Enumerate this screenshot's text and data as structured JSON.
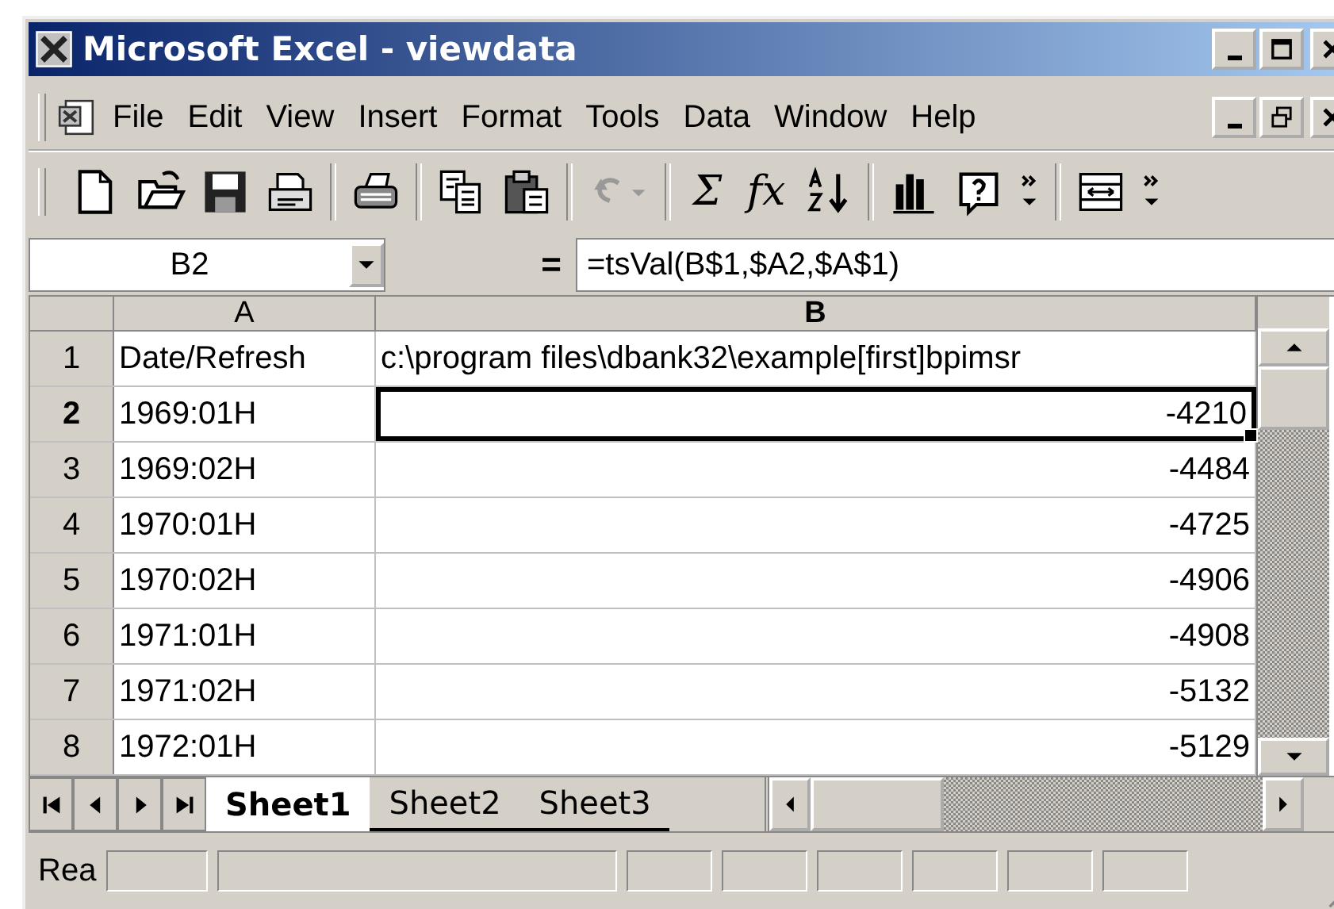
{
  "window": {
    "title": "Microsoft Excel - viewdata"
  },
  "menu": [
    {
      "label": "File"
    },
    {
      "label": "Edit"
    },
    {
      "label": "View"
    },
    {
      "label": "Insert"
    },
    {
      "label": "Format"
    },
    {
      "label": "Tools"
    },
    {
      "label": "Data"
    },
    {
      "label": "Window"
    },
    {
      "label": "Help"
    }
  ],
  "toolbar": [
    {
      "kind": "new"
    },
    {
      "kind": "open"
    },
    {
      "kind": "save"
    },
    {
      "kind": "mail"
    },
    {
      "kind": "sep"
    },
    {
      "kind": "print"
    },
    {
      "kind": "sep"
    },
    {
      "kind": "copy"
    },
    {
      "kind": "paste"
    },
    {
      "kind": "sep"
    },
    {
      "kind": "undo",
      "disabled": true
    },
    {
      "kind": "sep"
    },
    {
      "kind": "glyph",
      "text": "Σ"
    },
    {
      "kind": "glyph",
      "text": "fx"
    },
    {
      "kind": "sort"
    },
    {
      "kind": "sep"
    },
    {
      "kind": "chart"
    },
    {
      "kind": "help"
    },
    {
      "kind": "more"
    },
    {
      "kind": "sep"
    },
    {
      "kind": "merge"
    },
    {
      "kind": "more"
    }
  ],
  "formula_bar": {
    "name_box": "B2",
    "equals": "=",
    "formula": "=tsVal(B$1,$A2,$A$1)"
  },
  "columns": [
    {
      "label": "A",
      "selected": false
    },
    {
      "label": "B",
      "selected": true
    }
  ],
  "rows": [
    {
      "number": "1",
      "selected": false,
      "cells": [
        {
          "text": "Date/Refresh",
          "kind": "text",
          "active": false
        },
        {
          "text": "c:\\program files\\dbank32\\example[first]bpimsr",
          "kind": "text",
          "active": false
        }
      ]
    },
    {
      "number": "2",
      "selected": true,
      "cells": [
        {
          "text": "1969:01H",
          "kind": "text",
          "active": false
        },
        {
          "text": "-4210",
          "kind": "number",
          "active": true
        }
      ]
    },
    {
      "number": "3",
      "selected": false,
      "cells": [
        {
          "text": "1969:02H",
          "kind": "text",
          "active": false
        },
        {
          "text": "-4484",
          "kind": "number",
          "active": false
        }
      ]
    },
    {
      "number": "4",
      "selected": false,
      "cells": [
        {
          "text": "1970:01H",
          "kind": "text",
          "active": false
        },
        {
          "text": "-4725",
          "kind": "number",
          "active": false
        }
      ]
    },
    {
      "number": "5",
      "selected": false,
      "cells": [
        {
          "text": "1970:02H",
          "kind": "text",
          "active": false
        },
        {
          "text": "-4906",
          "kind": "number",
          "active": false
        }
      ]
    },
    {
      "number": "6",
      "selected": false,
      "cells": [
        {
          "text": "1971:01H",
          "kind": "text",
          "active": false
        },
        {
          "text": "-4908",
          "kind": "number",
          "active": false
        }
      ]
    },
    {
      "number": "7",
      "selected": false,
      "cells": [
        {
          "text": "1971:02H",
          "kind": "text",
          "active": false
        },
        {
          "text": "-5132",
          "kind": "number",
          "active": false
        }
      ]
    },
    {
      "number": "8",
      "selected": false,
      "cells": [
        {
          "text": "1972:01H",
          "kind": "text",
          "active": false
        },
        {
          "text": "-5129",
          "kind": "number",
          "active": false
        }
      ]
    }
  ],
  "sheet_tabs": [
    {
      "label": "Sheet1",
      "selected": true
    },
    {
      "label": "Sheet2",
      "selected": false
    },
    {
      "label": "Sheet3",
      "selected": false
    }
  ],
  "status_bar": {
    "text": "Rea"
  }
}
